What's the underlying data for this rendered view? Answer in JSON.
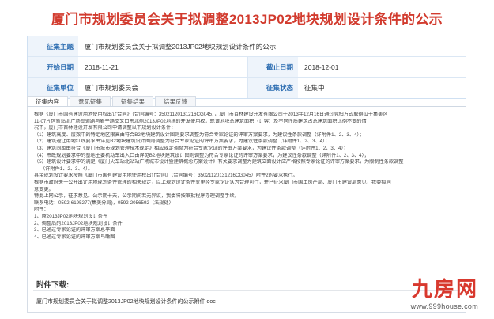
{
  "title": "厦门市规划委员会关于拟调整2013JP02地块规划设计条件的公示",
  "info": {
    "subject_label": "征集主题",
    "subject_value": "厦门市规划委员会关于拟调整2013JP02地块规划设计条件的公示",
    "start_label": "开始日期",
    "start_value": "2018-11-21",
    "end_label": "截止日期",
    "end_value": "2018-12-01",
    "unit_label": "征集单位",
    "unit_value": "厦门市规划委员会",
    "status_label": "征集状态",
    "status_value": "征集中"
  },
  "tabs": [
    "征集内容",
    "意见征集",
    "征集结果",
    "结果反馈"
  ],
  "content_lines": [
    "根据《厦门市国有建设用地使用权出让合同》（合同编号：35021120131216CG045），厦门市百林建设开发有限公司于2013年12月16日通过竞拍方式取得位于集美区",
    "11-07片区新站北广场岛道路与岩平路交叉口东北侧2013JP02地块的开发使用权。现该地块总建筑面积（计容）及不同性质建筑占总建筑面积比例不变的情",
    "况下，厦门市百林建设开发有限公司申请调整以下规划设计条件：",
    "（1）建筑高度、层数中的特定地区限高由符合B2地块建筑设计图则要求调整为符合专家论证的评审方案要求，为建议性条款调整（详附件1、2、3、4）；",
    "（2）建筑退让用地红线要求由详见B2地块建筑设计图则调整为符合专家论证的评审方案要求，为建议性条款调整（详附件1、2、3、4）；",
    "（3）建筑间距由符合《厦门市城市规划管理技术规定》相应规定调整为符合专家论证的评审方案要求，为建议性条款调整（详附件1、2、3、4）；",
    "（4）市政规划要求中的基地主要机动车出入口由详见B2地块建筑设计图则调整为符合专家论证的评审方案要求，为建议性条款调整（详附件1、2、3、4）；",
    "（5）建筑设计要求中的满足《厦门火车站北站站广场城市设计暨建筑概念方案设计》有关要求调整为建筑立面设计应严格按照专家论证的评审方案要求，为限制性条款调整",
    "（详附件1、2、3、4）。",
    "其余规划设计要求按照《厦门市国有建设用地使用权出让合同》（合同编号：35021120131216CG045）附件2的要求执行。",
    "根据市政府关于公开出让用地规划条件管理的相关规定，以上规划设计条件变更经专家论证认为合理可行，并已征求厦门市国土房产局、厦门市建设局意见，我委拟同",
    "意变更。",
    "特此上网公示，征求意见。公示期十天，公示期间若无异议，我委将按审批程序办理调整手续。",
    "联系电话：0592-6195277(集美分局)，0592-2056592（法规处）",
    "附件：",
    "1、原2013JP02地块规划设计条件",
    "2、调整后的2013JP02地块规划设计条件",
    "3、已通过专家论证的评审方案总平面",
    "4、已通过专家论证的评审方案鸟瞰图"
  ],
  "download": {
    "title": "附件下载:",
    "file": "厦门市规划委员会关于拟调整2013JP02地块规划设计条件的公示附件.doc"
  },
  "watermark": {
    "logo": "九房网",
    "url": "www.999house.com"
  }
}
